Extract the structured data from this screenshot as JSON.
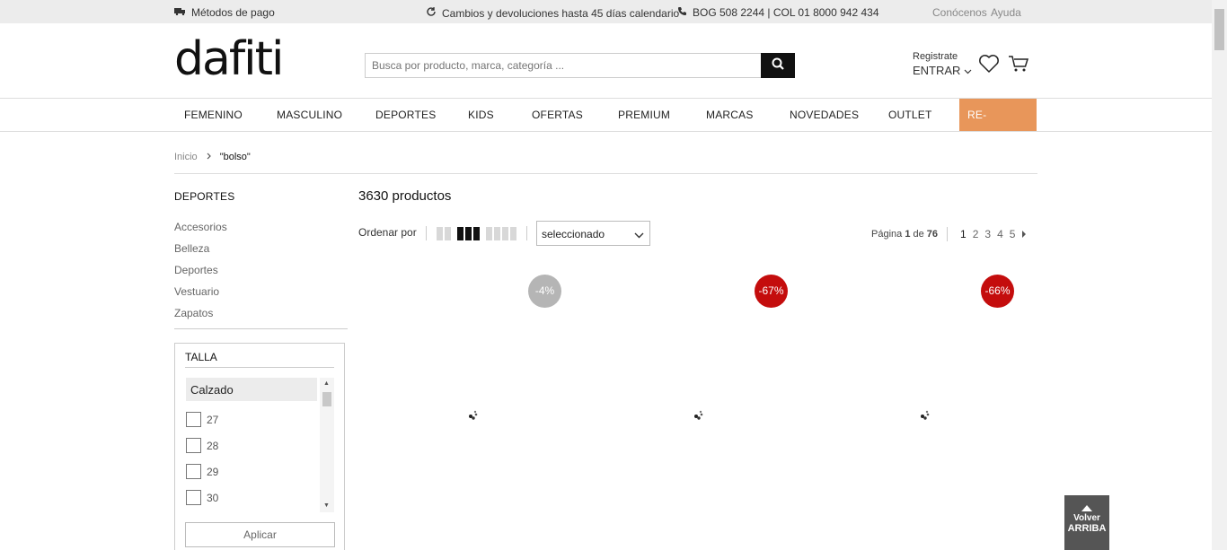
{
  "topbar": {
    "payment": "Métodos de pago",
    "returns": "Cambios y devoluciones hasta 45 días calendario",
    "phone": "BOG 508 2244 | COL 01 8000 942 434",
    "about": "Conócenos",
    "help": "Ayuda"
  },
  "header": {
    "logo": "dafiti",
    "search_placeholder": "Busca por producto, marca, categoría ...",
    "register": "Registrate",
    "login": "ENTRAR"
  },
  "nav": {
    "items": [
      "FEMENINO",
      "MASCULINO",
      "DEPORTES",
      "KIDS",
      "OFERTAS",
      "PREMIUM",
      "MARCAS",
      "NOVEDADES",
      "OUTLET",
      "RE-ACTÍVATE"
    ]
  },
  "breadcrumb": {
    "home": "Inicio",
    "current": "\"bolso\""
  },
  "sidebar": {
    "section_title": "DEPORTES",
    "categories": [
      "Accesorios",
      "Belleza",
      "Deportes",
      "Vestuario",
      "Zapatos"
    ],
    "filter": {
      "title": "TALLA",
      "group": "Calzado",
      "options": [
        "27",
        "28",
        "29",
        "30"
      ],
      "apply": "Aplicar"
    }
  },
  "main": {
    "count": "3630 productos",
    "sort_label": "Ordenar por",
    "sort_value": "seleccionado",
    "page_info": {
      "prefix": "Página ",
      "current": "1",
      "middle": " de ",
      "total": "76"
    },
    "pages": [
      "1",
      "2",
      "3",
      "4",
      "5"
    ],
    "products": [
      {
        "discount": "-4%",
        "badge_color": "#b5b5b5"
      },
      {
        "discount": "-67%",
        "badge_color": "#c40d0d"
      },
      {
        "discount": "-66%",
        "badge_color": "#c40d0d"
      }
    ]
  },
  "backtop": {
    "line1": "Volver",
    "line2": "ARRIBA"
  }
}
